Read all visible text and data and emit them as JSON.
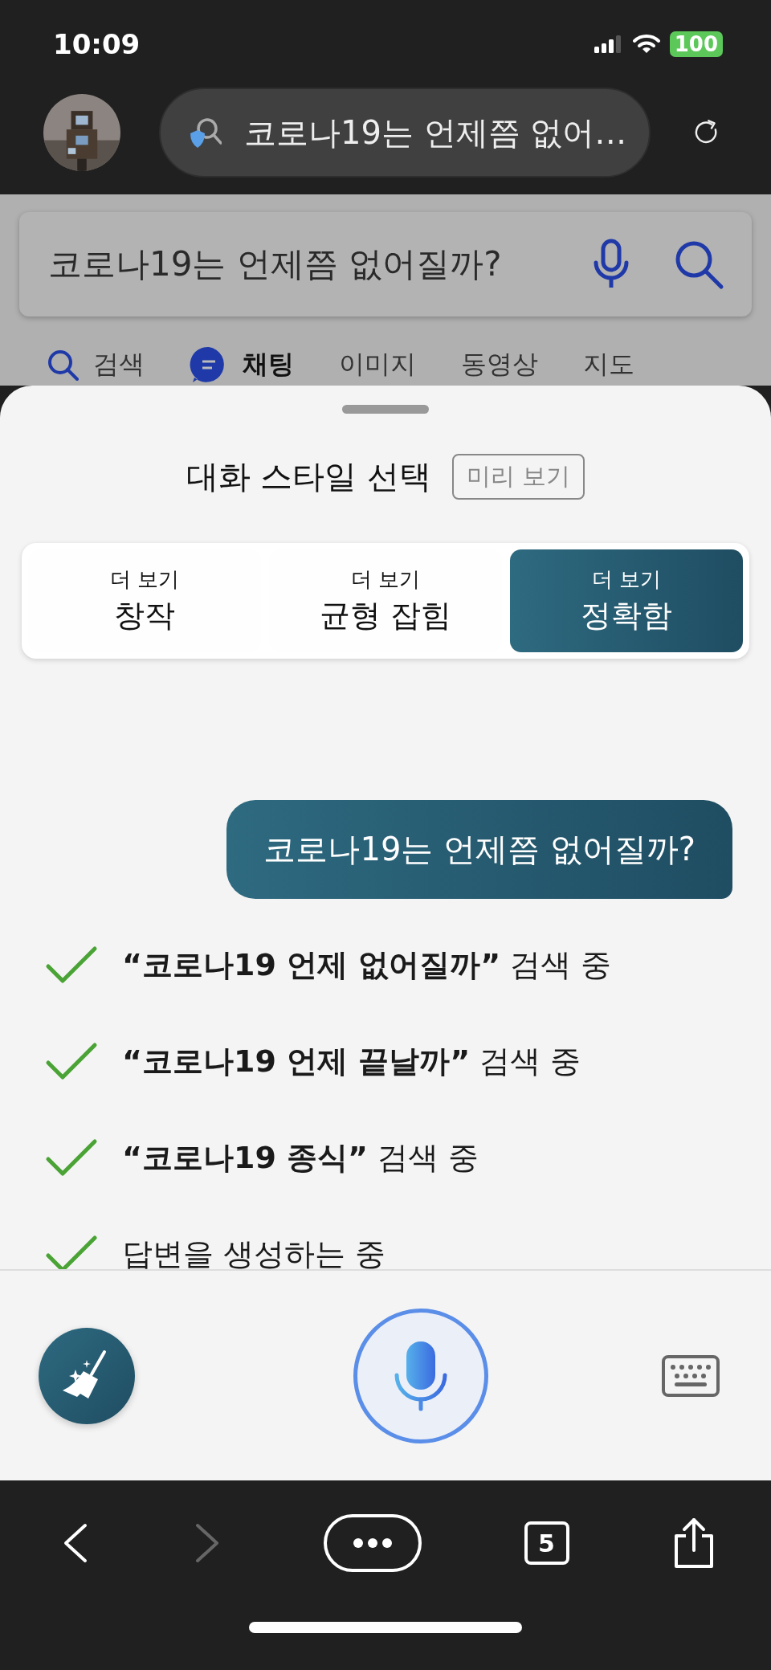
{
  "status_bar": {
    "time": "10:09",
    "battery": "100"
  },
  "address_bar": {
    "text": "코로나19는 언제쯤 없어…"
  },
  "search_box": {
    "value": "코로나19는 언제쯤 없어질까?"
  },
  "tabs": [
    {
      "label": "검색",
      "kind": "search",
      "selected": false
    },
    {
      "label": "채팅",
      "kind": "chat",
      "selected": true
    },
    {
      "label": "이미지",
      "kind": "text",
      "selected": false
    },
    {
      "label": "동영상",
      "kind": "text",
      "selected": false
    },
    {
      "label": "지도",
      "kind": "text",
      "selected": false
    }
  ],
  "sheet": {
    "title": "대화 스타일 선택",
    "preview_button": "미리 보기"
  },
  "styles": [
    {
      "hint": "더 보기",
      "label": "창작",
      "selected": false
    },
    {
      "hint": "더 보기",
      "label": "균형 잡힘",
      "selected": false
    },
    {
      "hint": "더 보기",
      "label": "정확함",
      "selected": true
    }
  ],
  "user_message": "코로나19는 언제쯤 없어질까?",
  "steps": [
    {
      "text": "**“코로나19 언제 없어질까”** 검색 중",
      "done": true
    },
    {
      "text": "**“코로나19 언제 끝날까”** 검색 중",
      "done": true
    },
    {
      "text": "**“코로나19 종식”** 검색 중",
      "done": true
    },
    {
      "text": "답변을 생성하는 중",
      "done": true
    }
  ],
  "bottom_nav": {
    "back_disabled": false,
    "forward_disabled": true,
    "tab_count": "5"
  }
}
